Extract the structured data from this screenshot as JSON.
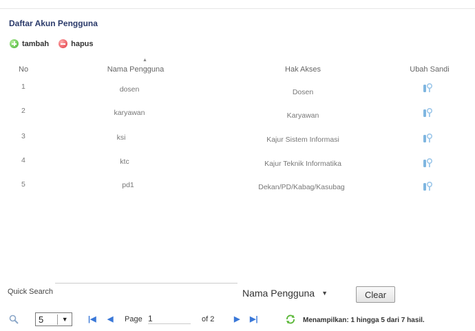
{
  "panel": {
    "title": "Daftar Akun Pengguna"
  },
  "actions": {
    "add_label": "tambah",
    "delete_label": "hapus"
  },
  "table": {
    "headers": {
      "no": "No",
      "name": "Nama Pengguna",
      "access": "Hak Akses",
      "change_password": "Ubah Sandi"
    },
    "rows": [
      {
        "no": "1",
        "name": "dosen",
        "access": "Dosen"
      },
      {
        "no": "2",
        "name": "karyawan",
        "access": "Karyawan"
      },
      {
        "no": "3",
        "name": "ksi",
        "access": "Kajur Sistem Informasi"
      },
      {
        "no": "4",
        "name": "ktc",
        "access": "Kajur Teknik Informatika"
      },
      {
        "no": "5",
        "name": "pd1",
        "access": "Dekan/PD/Kabag/Kasubag"
      }
    ],
    "row_icon": "key-icon"
  },
  "quick_search": {
    "label": "Quick Search",
    "field": "Nama Pengguna",
    "clear_label": "Clear"
  },
  "pagination": {
    "per_page": "5",
    "page_label": "Page",
    "page": "1",
    "of_total": "of 2",
    "status": "Menampilkan: 1 hingga 5 dari 7 hasil."
  },
  "colors": {
    "title": "#2a3a6a",
    "nav_blue": "#3a78d8",
    "add_green": "#3fae2a",
    "delete_red": "#e0303a"
  }
}
